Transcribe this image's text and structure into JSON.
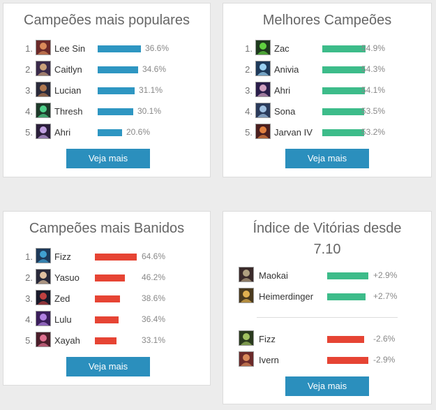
{
  "popular": {
    "title": "Campeões mais populares",
    "button": "Veja mais",
    "items": [
      {
        "rank": "1.",
        "name": "Lee Sin",
        "pct": "36.6%",
        "value": 36.6
      },
      {
        "rank": "2.",
        "name": "Caitlyn",
        "pct": "34.6%",
        "value": 34.6
      },
      {
        "rank": "3.",
        "name": "Lucian",
        "pct": "31.1%",
        "value": 31.1
      },
      {
        "rank": "4.",
        "name": "Thresh",
        "pct": "30.1%",
        "value": 30.1
      },
      {
        "rank": "5.",
        "name": "Ahri",
        "pct": "20.6%",
        "value": 20.6
      }
    ]
  },
  "best": {
    "title": "Melhores Campeões",
    "button": "Veja mais",
    "items": [
      {
        "rank": "1.",
        "name": "Zac",
        "pct": "54.9%",
        "value": 54.9
      },
      {
        "rank": "2.",
        "name": "Anivia",
        "pct": "54.3%",
        "value": 54.3
      },
      {
        "rank": "3.",
        "name": "Ahri",
        "pct": "54.1%",
        "value": 54.1
      },
      {
        "rank": "4.",
        "name": "Sona",
        "pct": "53.5%",
        "value": 53.5
      },
      {
        "rank": "5.",
        "name": "Jarvan IV",
        "pct": "53.2%",
        "value": 53.2
      }
    ]
  },
  "banned": {
    "title": "Campeões mais Banidos",
    "button": "Veja mais",
    "items": [
      {
        "rank": "1.",
        "name": "Fizz",
        "pct": "64.6%",
        "value": 64.6
      },
      {
        "rank": "2.",
        "name": "Yasuo",
        "pct": "46.2%",
        "value": 46.2
      },
      {
        "rank": "3.",
        "name": "Zed",
        "pct": "38.6%",
        "value": 38.6
      },
      {
        "rank": "4.",
        "name": "Lulu",
        "pct": "36.4%",
        "value": 36.4
      },
      {
        "rank": "5.",
        "name": "Xayah",
        "pct": "33.1%",
        "value": 33.1
      }
    ]
  },
  "winrate": {
    "title_line1": "Índice de Vitórias desde",
    "title_line2": "7.10",
    "button": "Veja mais",
    "gainers": [
      {
        "name": "Maokai",
        "pct": "+2.9%",
        "value": 2.9
      },
      {
        "name": "Heimerdinger",
        "pct": "+2.7%",
        "value": 2.7
      }
    ],
    "losers": [
      {
        "name": "Fizz",
        "pct": "-2.6%",
        "value": 2.6
      },
      {
        "name": "Ivern",
        "pct": "-2.9%",
        "value": 2.9
      }
    ]
  },
  "colors": {
    "popular_bar": "#2e96c2",
    "best_bar": "#3dbc8a",
    "banned_bar": "#e64434",
    "button": "#2b8fbd"
  },
  "icons": {
    "champion_portrait": "champion-portrait-icon"
  }
}
